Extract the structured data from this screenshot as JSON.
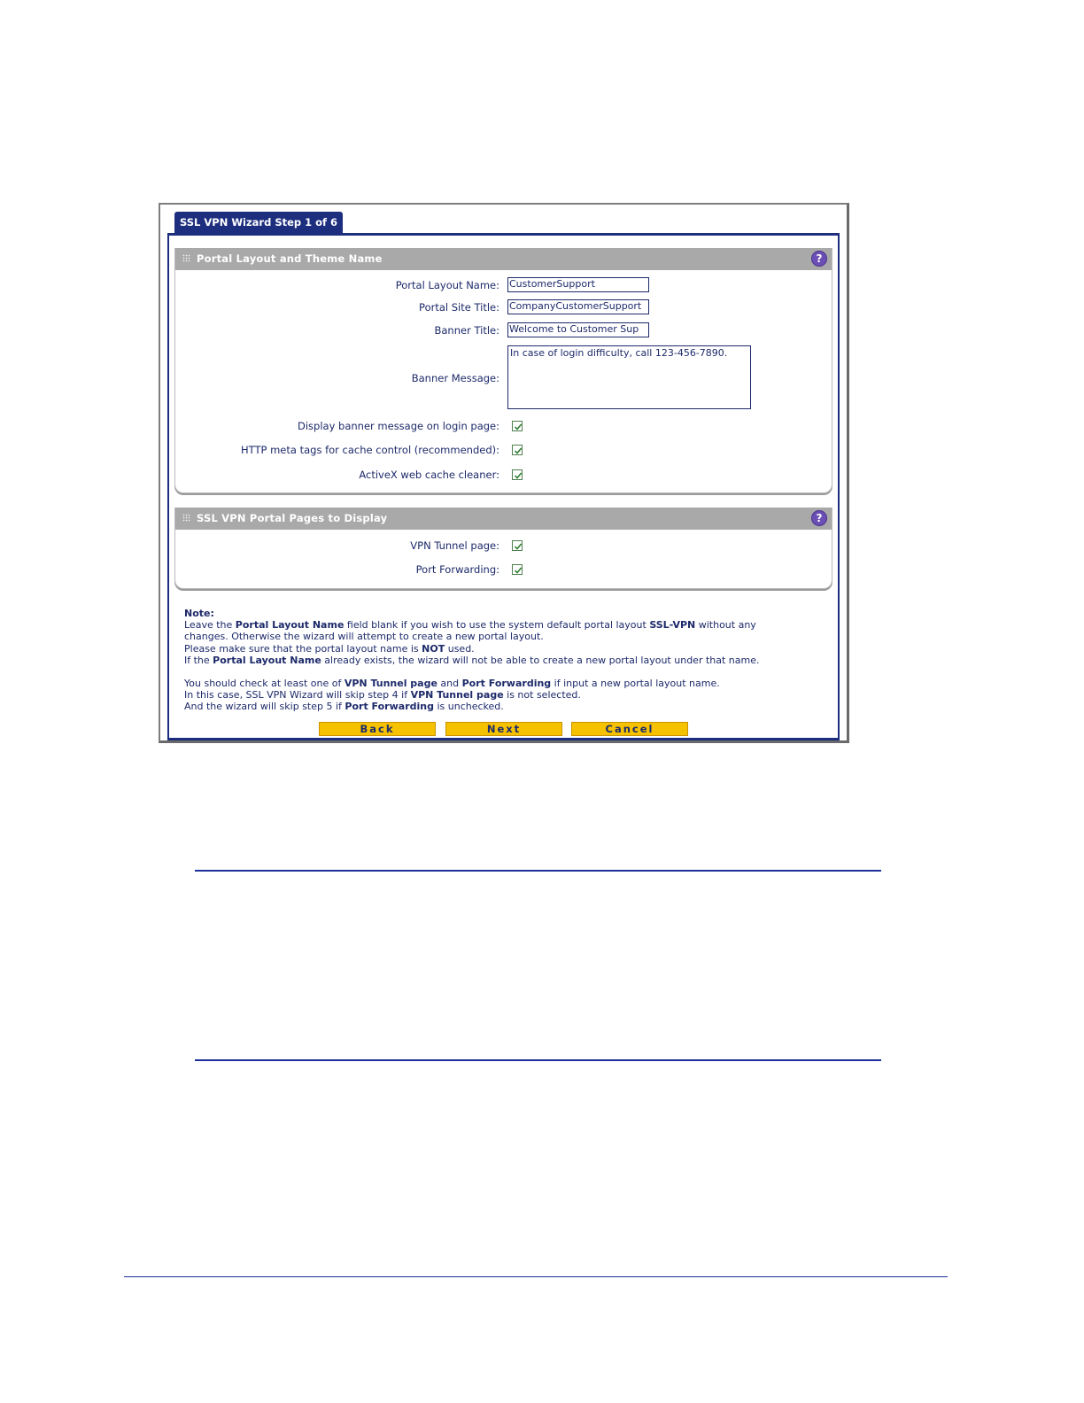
{
  "wizard": {
    "tab_title": "SSL VPN Wizard Step 1 of 6",
    "section1": {
      "title": "Portal Layout and Theme Name",
      "portal_layout_name_label": "Portal Layout Name:",
      "portal_layout_name_value": "CustomerSupport",
      "portal_site_title_label": "Portal Site Title:",
      "portal_site_title_value": "CompanyCustomerSupport",
      "banner_title_label": "Banner Title:",
      "banner_title_value": "Welcome to Customer Sup",
      "banner_message_label": "Banner Message:",
      "banner_message_value": "In case of  login difficulty, call 123-456-7890.",
      "display_banner_label": "Display banner message on login page:",
      "display_banner_checked": true,
      "http_meta_label": "HTTP meta tags for cache control (recommended):",
      "http_meta_checked": true,
      "activex_label": "ActiveX web cache cleaner:",
      "activex_checked": true
    },
    "section2": {
      "title": "SSL VPN Portal Pages to Display",
      "vpn_tunnel_label": "VPN Tunnel page:",
      "vpn_tunnel_checked": true,
      "port_forwarding_label": "Port Forwarding:",
      "port_forwarding_checked": true
    },
    "note": {
      "heading": "Note:",
      "l1_a": "Leave the ",
      "l1_b": "Portal Layout Name",
      "l1_c": " field blank if you wish to use the system default portal layout ",
      "l1_d": "SSL-VPN",
      "l1_e": " without any",
      "l2": "changes. Otherwise the wizard will attempt to create a new portal layout.",
      "l3_a": "Please make sure that the portal layout name is ",
      "l3_b": "NOT",
      "l3_c": " used.",
      "l4_a": "If the ",
      "l4_b": "Portal Layout Name",
      "l4_c": " already exists, the wizard will not be able to create a new portal layout under that name.",
      "l5_a": "You should check at least one of ",
      "l5_b": "VPN Tunnel page",
      "l5_c": " and ",
      "l5_d": "Port Forwarding",
      "l5_e": " if input a new portal layout name.",
      "l6_a": "In this case, SSL VPN Wizard will skip step 4 if ",
      "l6_b": "VPN Tunnel page",
      "l6_c": " is not selected.",
      "l7_a": "And the wizard will skip step 5 if ",
      "l7_b": "Port Forwarding",
      "l7_c": " is unchecked."
    },
    "buttons": {
      "back": "Back",
      "next": "Next",
      "cancel": "Cancel"
    }
  },
  "colors": {
    "rule": "#1d2f9a",
    "tab_bg": "#1d2e7e",
    "button": "#f6c200",
    "section_header": "#a9a9a9"
  }
}
